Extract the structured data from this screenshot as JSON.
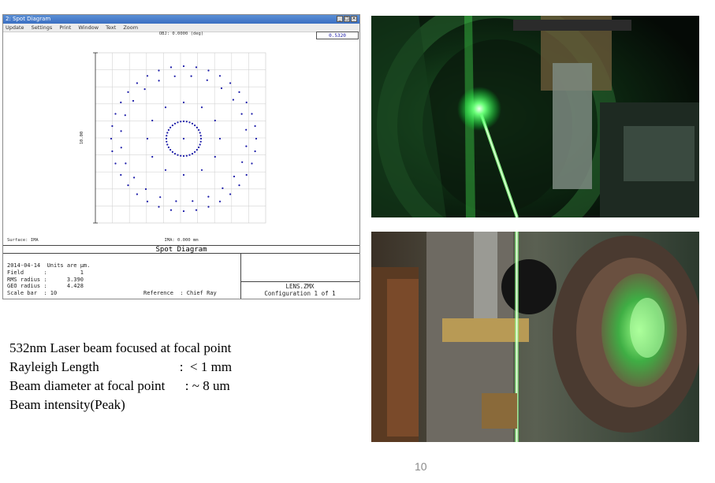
{
  "window": {
    "title": "2: Spot Diagram",
    "menu": [
      "Update",
      "Settings",
      "Print",
      "Window",
      "Text",
      "Zoom"
    ]
  },
  "plot": {
    "obj_label": "OBJ: 0.0000 (deg)",
    "wavelength": "0.5320",
    "scale_label": "10.00",
    "surface_label": "Surface: IMA",
    "ima_label": "IMA: 0.000 mm"
  },
  "panel_title": "Spot Diagram",
  "info": {
    "line1": "2014-04-14  Units are µm.",
    "line2": "Field      :          1",
    "line3": "RMS radius :      3.390",
    "line4": "GEO radius :      4.428",
    "line5": "Scale bar  : 10",
    "reference": "Reference  : Chief Ray",
    "file": "LENS.ZMX",
    "config": "Configuration 1 of 1"
  },
  "caption": {
    "line1": "532nm Laser beam focused at focal point",
    "line2": "Rayleigh Length                        :  < 1 mm",
    "line3": "Beam diameter at focal point      : ~ 8 um",
    "line4": "Beam intensity(Peak)"
  },
  "page_number": "10",
  "colors": {
    "spot": "#1a1aa8",
    "laser": "#39ff5a"
  }
}
